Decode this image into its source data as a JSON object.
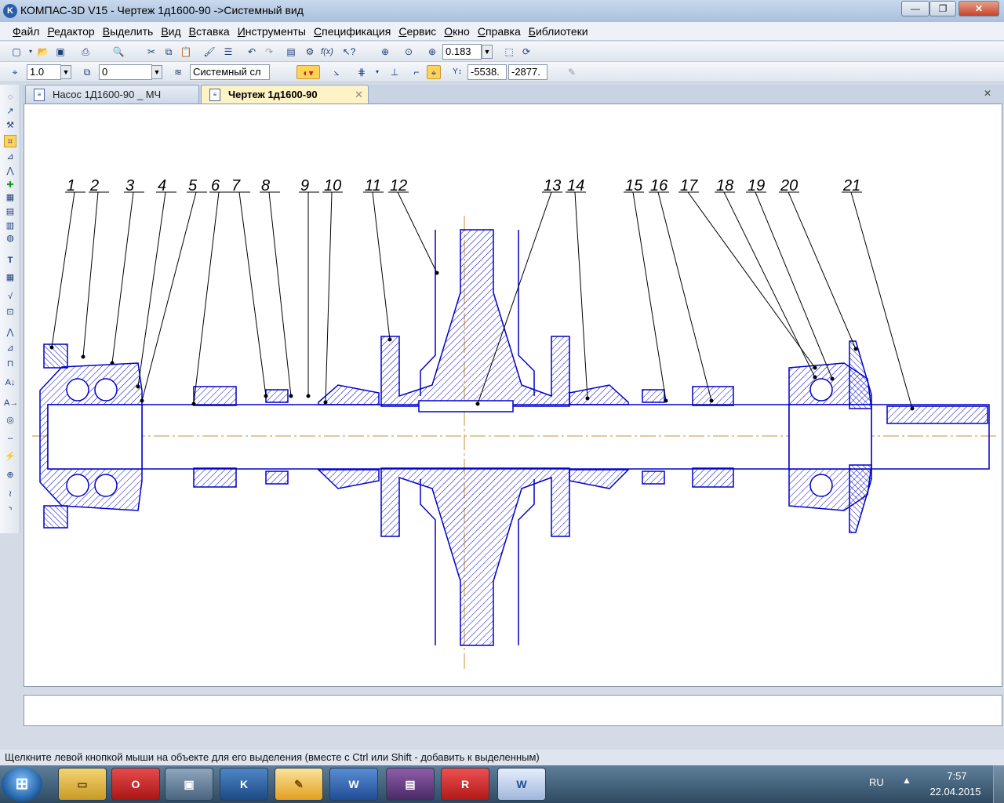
{
  "window": {
    "title": "КОМПАС-3D V15 - Чертеж 1д1600-90 ->Системный вид",
    "minimize_glyph": "—",
    "maximize_glyph": "❐",
    "close_glyph": "✕"
  },
  "menu": [
    {
      "label": "Файл",
      "underline": "Ф",
      "rest": "айл"
    },
    {
      "label": "Редактор",
      "underline": "Р",
      "rest": "едактор"
    },
    {
      "label": "Выделить",
      "underline": "В",
      "rest": "ыделить"
    },
    {
      "label": "Вид",
      "underline": "В",
      "rest": "ид"
    },
    {
      "label": "Вставка",
      "underline": "В",
      "rest": "ставка"
    },
    {
      "label": "Инструменты",
      "underline": "И",
      "rest": "нструменты"
    },
    {
      "label": "Спецификация",
      "underline": "С",
      "rest": "пецификация"
    },
    {
      "label": "Сервис",
      "underline": "С",
      "rest": "ервис"
    },
    {
      "label": "Окно",
      "underline": "О",
      "rest": "кно"
    },
    {
      "label": "Справка",
      "underline": "С",
      "rest": "правка"
    },
    {
      "label": "Библиотеки",
      "underline": "Б",
      "rest": "иблиотеки"
    }
  ],
  "toolbar1": {
    "zoom_value": "0.183"
  },
  "toolbar2": {
    "step_value": "1.0",
    "angle_value": "0",
    "layer_value": "Системный сл",
    "coord_x": "-5538.",
    "coord_y": "-2877."
  },
  "tabs": [
    {
      "label": "Насос 1Д1600-90 _ МЧ",
      "active": false
    },
    {
      "label": "Чертеж 1д1600-90",
      "active": true,
      "close": "✕"
    }
  ],
  "drawing": {
    "callouts": [
      "1",
      "2",
      "3",
      "4",
      "5",
      "6",
      "7",
      "8",
      "9",
      "10",
      "11",
      "12",
      "13",
      "14",
      "15",
      "16",
      "17",
      "18",
      "19",
      "20",
      "21"
    ],
    "line_color": "#0000cc",
    "axis_color": "#c8903a"
  },
  "status": {
    "hint": "Щелкните левой кнопкой мыши на объекте для его выделения (вместе с Ctrl или Shift - добавить к выделенным)"
  },
  "taskbar": {
    "start": "⊞",
    "lang": "RU",
    "tray_arrow": "▲",
    "time": "7:57",
    "date": "22.04.2015"
  }
}
